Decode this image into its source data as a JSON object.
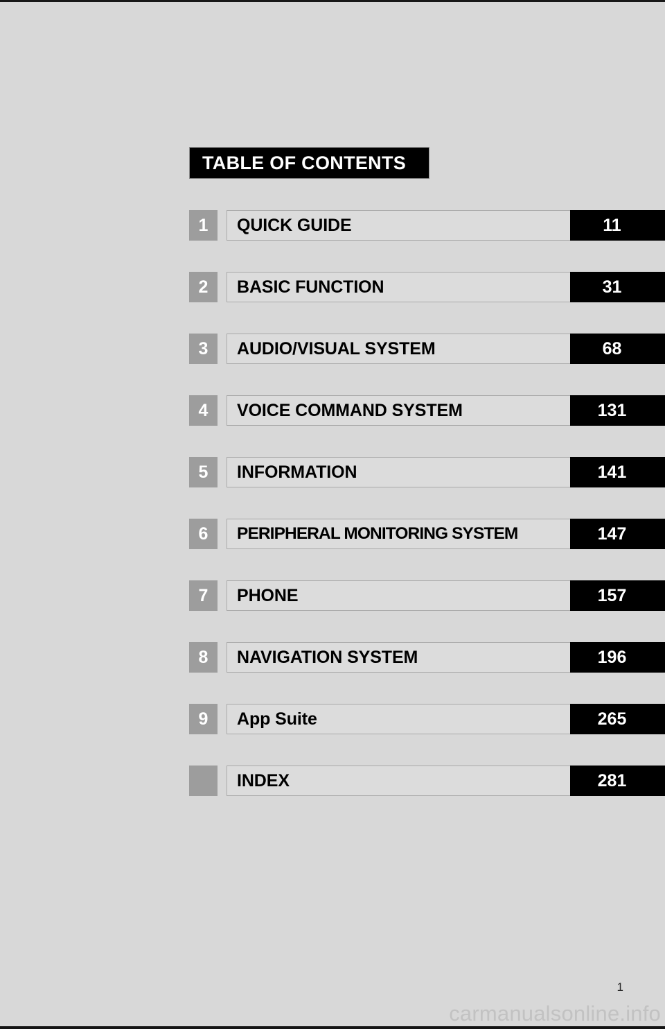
{
  "page": {
    "background_color": "#d8d8d8",
    "footer_page_number": "1",
    "watermark": "carmanualsonline.info"
  },
  "banner": {
    "title": "TABLE OF CONTENTS"
  },
  "contents": {
    "rows": [
      {
        "number": "1",
        "title": "QUICK GUIDE",
        "page": "11"
      },
      {
        "number": "2",
        "title": "BASIC FUNCTION",
        "page": "31"
      },
      {
        "number": "3",
        "title": "AUDIO/VISUAL SYSTEM",
        "page": "68"
      },
      {
        "number": "4",
        "title": "VOICE COMMAND SYSTEM",
        "page": "131"
      },
      {
        "number": "5",
        "title": "INFORMATION",
        "page": "141"
      },
      {
        "number": "6",
        "title": "PERIPHERAL MONITORING SYSTEM",
        "page": "147"
      },
      {
        "number": "7",
        "title": "PHONE",
        "page": "157"
      },
      {
        "number": "8",
        "title": "NAVIGATION SYSTEM",
        "page": "196"
      },
      {
        "number": "9",
        "title": "App Suite",
        "page": "265"
      },
      {
        "number": "",
        "title": "INDEX",
        "page": "281"
      }
    ]
  }
}
